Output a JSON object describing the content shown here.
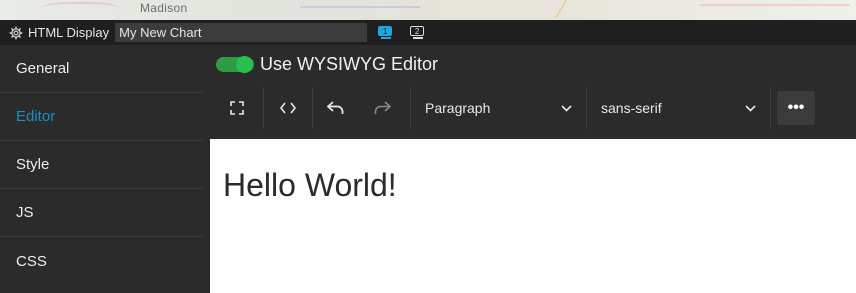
{
  "background_map": {
    "label": "Madison"
  },
  "titlebar": {
    "icon": "gear-icon",
    "title": "HTML Display",
    "chart_name_value": "My New Chart",
    "display_buttons": [
      {
        "number": "1",
        "icon": "monitor-icon",
        "active": true
      },
      {
        "number": "2",
        "icon": "monitor-icon",
        "active": false
      }
    ]
  },
  "sidebar": {
    "items": [
      {
        "label": "General",
        "active": false
      },
      {
        "label": "Editor",
        "active": true
      },
      {
        "label": "Style",
        "active": false
      },
      {
        "label": "JS",
        "active": false
      },
      {
        "label": "CSS",
        "active": false
      }
    ]
  },
  "editor_panel": {
    "toggle_label": "Use WYSIWYG Editor",
    "toggle_on": true,
    "toolbar": {
      "fullscreen_icon": "fullscreen-icon",
      "code_view_icon": "code-icon",
      "undo_icon": "undo-icon",
      "redo_icon": "redo-icon",
      "paragraph_format": "Paragraph",
      "font_family": "sans-serif",
      "more_icon": "more-icon",
      "more_glyph": "•••"
    },
    "content": "Hello World!"
  },
  "colors": {
    "accent": "#1a8fc4",
    "toggle_on": "#27c24c",
    "panel_bg": "#2b2b2b",
    "titlebar_bg": "#1f1f1f"
  }
}
